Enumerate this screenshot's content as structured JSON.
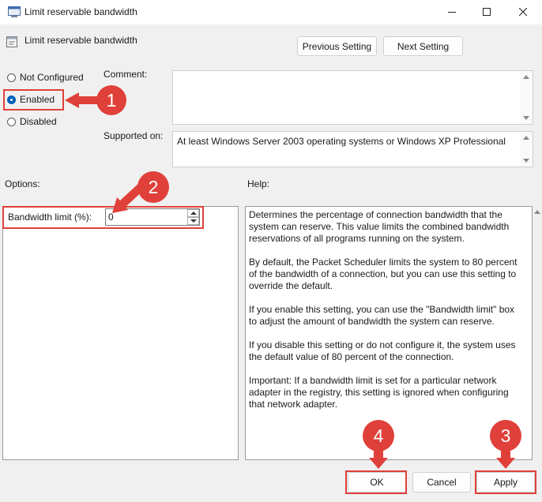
{
  "window": {
    "title": "Limit reservable bandwidth"
  },
  "header": {
    "policy_name": "Limit reservable bandwidth",
    "prev_label": "Previous Setting",
    "next_label": "Next Setting"
  },
  "state_options": [
    {
      "label": "Not Configured",
      "selected": false
    },
    {
      "label": "Enabled",
      "selected": true
    },
    {
      "label": "Disabled",
      "selected": false
    }
  ],
  "comment": {
    "label": "Comment:",
    "value": ""
  },
  "supported": {
    "label": "Supported on:",
    "value": "At least Windows Server 2003 operating systems or Windows XP Professional"
  },
  "options": {
    "label": "Options:",
    "bandwidth_label": "Bandwidth limit (%):",
    "bandwidth_value": "0"
  },
  "help": {
    "label": "Help:",
    "paragraphs": [
      "Determines the percentage of connection bandwidth that the system can reserve. This value limits the combined bandwidth reservations of all programs running on the system.",
      "By default, the Packet Scheduler limits the system to 80 percent of the bandwidth of a connection, but you can use this setting to override the default.",
      "If you enable this setting, you can use the \"Bandwidth limit\" box to adjust the amount of bandwidth the system can reserve.",
      "If you disable this setting or do not configure it, the system uses the default value of 80 percent of the connection.",
      "Important: If a bandwidth limit is set for a particular network adapter in the registry, this setting is ignored when configuring that network adapter."
    ]
  },
  "footer": {
    "ok_label": "OK",
    "cancel_label": "Cancel",
    "apply_label": "Apply"
  },
  "callouts": [
    "1",
    "2",
    "3",
    "4"
  ],
  "colors": {
    "annotation": "#e0403a",
    "radio_selected": "#005fb8"
  }
}
